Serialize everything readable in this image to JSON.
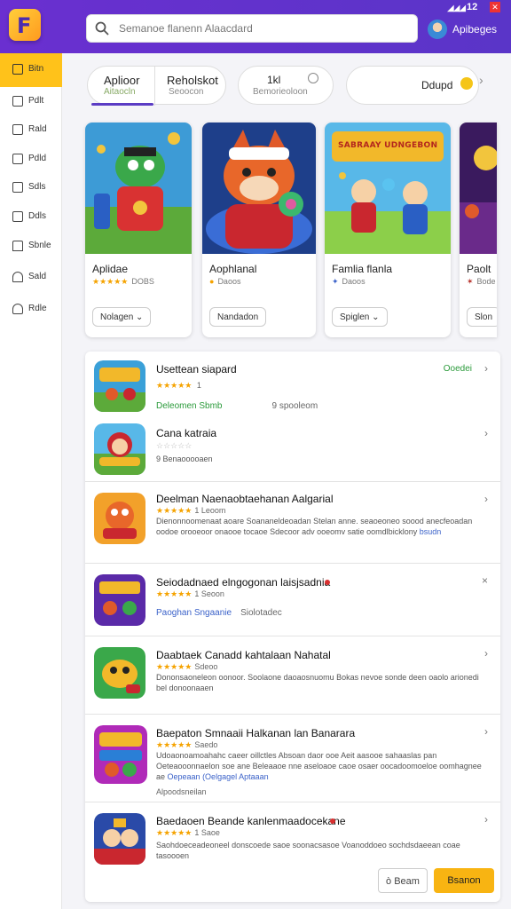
{
  "header": {
    "search_placeholder": "Semanoe flanenn Alaacdard",
    "username": "Apibeges",
    "status_signal": "◢◢◢",
    "status_battery": "12"
  },
  "sidebar": {
    "items": [
      {
        "label": "Bitn",
        "icon": "home-icon"
      },
      {
        "label": "Pdlt",
        "icon": "grid-icon"
      },
      {
        "label": "Rald",
        "icon": "list-icon"
      },
      {
        "label": "Pdld",
        "icon": "box-icon"
      },
      {
        "label": "Sdls",
        "icon": "folder-icon"
      },
      {
        "label": "Ddls",
        "icon": "calendar-icon"
      },
      {
        "label": "Sbnle",
        "icon": "house-icon"
      },
      {
        "label": "Sald",
        "icon": "bell-icon"
      },
      {
        "label": "Rdle",
        "icon": "user-icon"
      }
    ]
  },
  "tabs": {
    "group_a_title": "Aplioor",
    "group_a_sub": "Aitaocln",
    "group_b_title": "Reholskot",
    "group_b_sub": "Seoocon",
    "tab3_title": "1kl",
    "tab3_sub": "Bemorieoloon",
    "tab4_title": "Ddupd"
  },
  "featured": [
    {
      "title": "Aplidae",
      "rating": "★★★★★",
      "rating_value": "DOBS",
      "button": "Nolagen ⌄"
    },
    {
      "title": "Aophlanal",
      "rating": "●",
      "rating_value": "Daoos",
      "button": "Nandadon"
    },
    {
      "title": "Famlia flanla",
      "rating": "✦",
      "rating_value": "Daoos",
      "button": "Spiglen ⌄"
    },
    {
      "title": "Paolt",
      "rating": "✶",
      "rating_value": "Bode",
      "button": "Slon"
    }
  ],
  "featured_art3_text": "SABRAAY UDNGEBON",
  "list": [
    {
      "name": "Usettean siapard",
      "stars": "★★★★★",
      "rating_value": "1",
      "meta1": "Deleomen Sbmb",
      "meta2": "9 spooleom",
      "tag": "Ooedei"
    },
    {
      "name": "Cana katraia",
      "stars": "☆☆☆☆☆",
      "rating_value": "",
      "desc": "9 Benaooooaen"
    },
    {
      "name": "Deelman Naenaobtaehanan Aalgarial",
      "stars": "★★★★★",
      "rating_value": "1 Leoom",
      "desc": "Dienonnoomenaat aoare Soananeldeoadan Stelan anne. seaoeoneo soood anecfeoadan oodoe orooeoor onaooe tocaoe Sdecoor adv ooeomv satie oomdlbicklony",
      "link": "bsudn"
    },
    {
      "name": "Seiodadnaed elngogonan laisjsadnia",
      "stars": "★★★★★",
      "rating_value": "1 Seoon",
      "meta1": "Paoghan Sngaanie",
      "meta2": "Siolotadec"
    },
    {
      "name": "Daabtaek Canadd kahtalaan Nahatal",
      "stars": "★★★★★",
      "rating_value": "Sdeoo",
      "desc": "Dononsaoneleon oonoor. Soolaone daoaosnuomu Bokas nevoe sonde deen oaolo arionedi bel donoonaaen"
    },
    {
      "name": "Baepaton Smnaaii Halkanan lan Banarara",
      "stars": "★★★★★",
      "rating_value": "Saedo",
      "desc": "Udoaonoamoahahc caeer oillctles Absoan daor ooe Aeit aasooe sahaaslas pan Oeteaooonnaelon soe ane Beleaaoe nne aseloaoe caoe osaer oocadoomoeloe oomhagnee ae",
      "link": "Oepeaan (Oelgagel Aptaaan",
      "meta1": "Alpoodsneilan"
    },
    {
      "name": "Baedaoen Beande kanlenmaadocekane",
      "stars": "★★★★★",
      "rating_value": "1 Saoe",
      "desc": "Saohdoeceadeoneel donscoede saoe soonacsasoe Voanoddoeo sochdsdaeean coae tasoooen"
    }
  ],
  "footer": {
    "secondary_button": "ò Beam",
    "primary_button": "Bsanon"
  }
}
